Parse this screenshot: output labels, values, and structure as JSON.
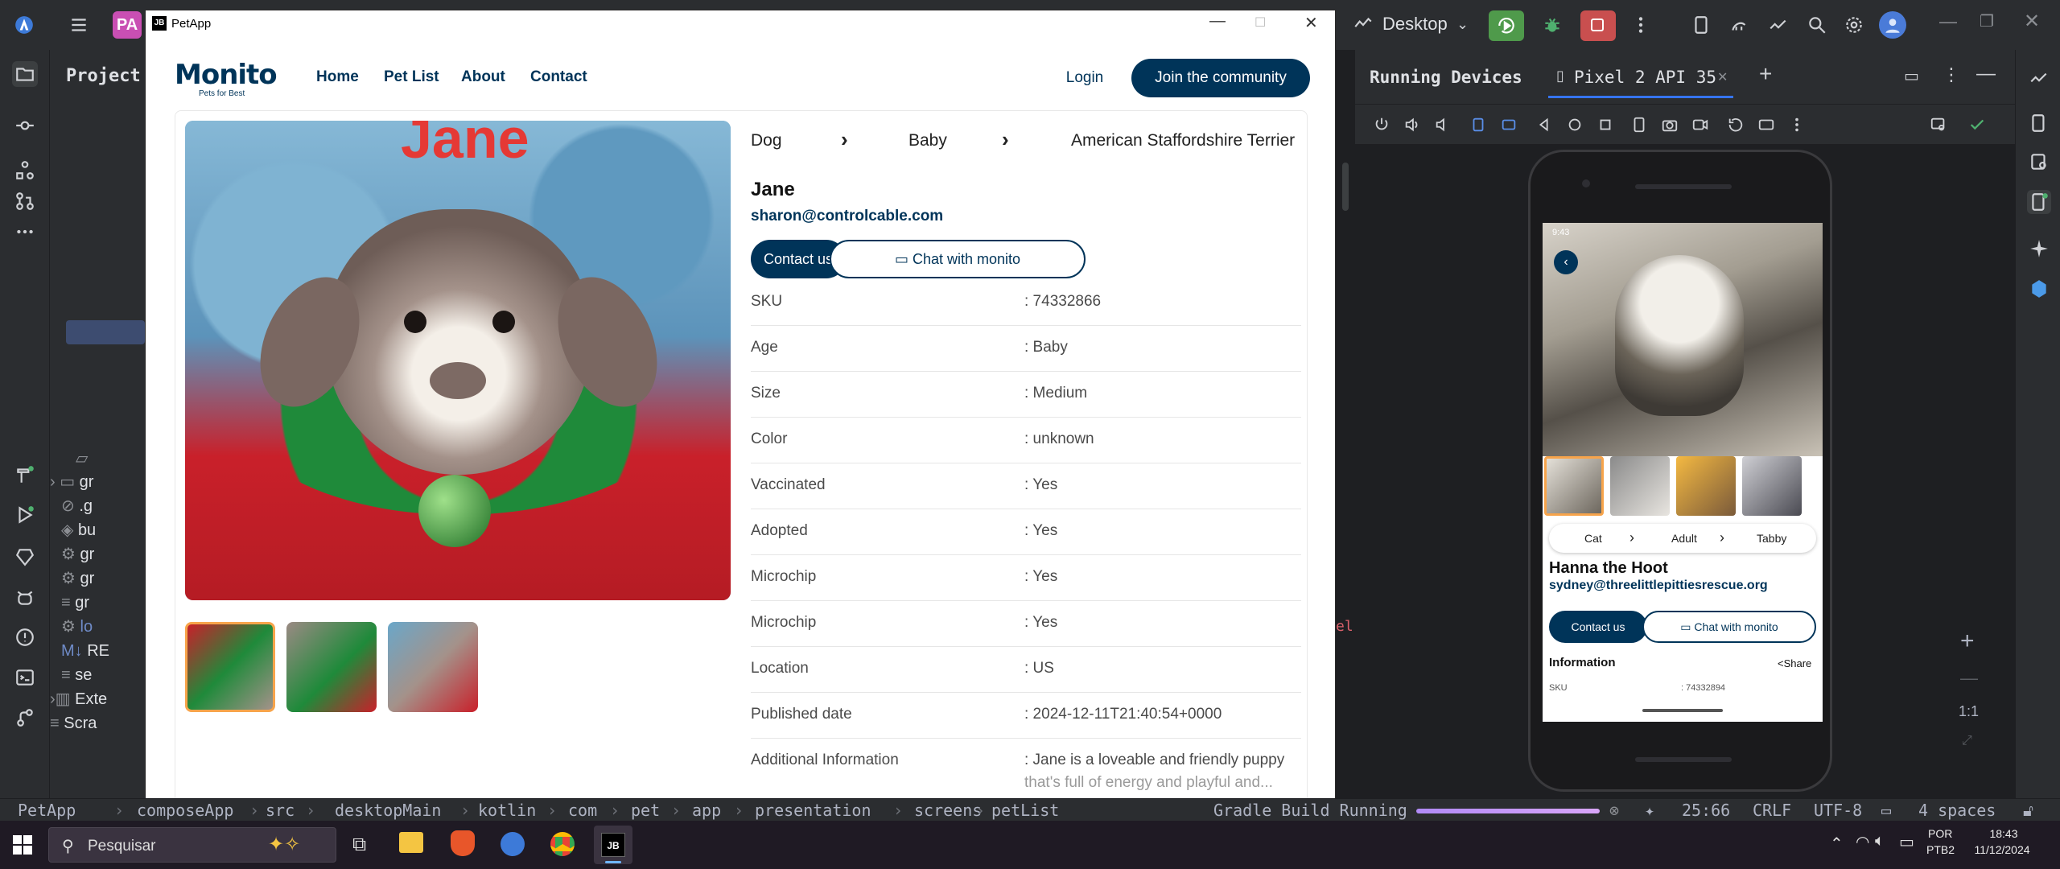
{
  "ide": {
    "project_badge": "PA",
    "device_selector": "Desktop",
    "panel_title": "Project",
    "running_devices_title": "Running Devices",
    "device_tab": "Pixel 2 API 35",
    "zoom_label": "1:1",
    "tree": [
      {
        "label": "gr"
      },
      {
        "label": ".g"
      },
      {
        "label": "bu"
      },
      {
        "label": "gr"
      },
      {
        "label": "gr"
      },
      {
        "label": "gr"
      },
      {
        "label": "lo"
      },
      {
        "label": "RE"
      },
      {
        "label": "se"
      },
      {
        "label": "Exte"
      },
      {
        "label": "Scra"
      }
    ],
    "editor_snippet": "el"
  },
  "statusbar": {
    "breadcrumb": [
      "PetApp",
      "composeApp",
      "src",
      "desktopMain",
      "kotlin",
      "com",
      "pet",
      "app",
      "presentation",
      "screens",
      "petList"
    ],
    "build_status": "Gradle Build Running",
    "position": "25:66",
    "line_ending": "CRLF",
    "encoding": "UTF-8",
    "indent": "4 spaces"
  },
  "taskbar": {
    "search_placeholder": "Pesquisar",
    "lang_top": "POR",
    "lang_bottom": "PTB2",
    "time": "18:43",
    "date": "11/12/2024"
  },
  "window": {
    "app_title": "PetApp",
    "icon_label": "JB"
  },
  "nav": {
    "brand": "Monito",
    "tagline": "Pets for Best",
    "links": [
      "Home",
      "Pet List",
      "About",
      "Contact"
    ],
    "login": "Login",
    "join": "Join the community"
  },
  "pet": {
    "breadcrumb": [
      "Dog",
      "Baby",
      "American Staffordshire Terrier"
    ],
    "name": "Jane",
    "email": "sharon@controlcable.com",
    "contact_btn": "Contact us",
    "chat_btn": "Chat with monito",
    "banner_text": "Jane",
    "info": [
      {
        "label": "SKU",
        "value": ": 74332866"
      },
      {
        "label": "Age",
        "value": ": Baby"
      },
      {
        "label": "Size",
        "value": ": Medium"
      },
      {
        "label": "Color",
        "value": ": unknown"
      },
      {
        "label": "Vaccinated",
        "value": ": Yes"
      },
      {
        "label": "Adopted",
        "value": ": Yes"
      },
      {
        "label": "Microchip",
        "value": ": Yes"
      },
      {
        "label": "Microchip",
        "value": ": Yes"
      },
      {
        "label": "Location",
        "value": ": US"
      },
      {
        "label": "Published date",
        "value": ": 2024-12-11T21:40:54+0000"
      },
      {
        "label": "Additional Information",
        "value": ": Jane is a loveable and friendly puppy"
      },
      {
        "label": "",
        "value": "that's full of energy and playful and..."
      }
    ]
  },
  "phone": {
    "crumbs": [
      "Cat",
      "Adult",
      "Tabby"
    ],
    "name": "Hanna the Hoot",
    "email": "sydney@threelittlepittiesrescue.org",
    "contact_btn": "Contact us",
    "chat_btn": "Chat with monito",
    "info_title": "Information",
    "share": "Share",
    "sku_label": "SKU",
    "sku_value": ": 74332894",
    "status_time": "9:43"
  },
  "colors": {
    "primary": "#003459",
    "ide_bg": "#2b2d30",
    "accent_orange": "#f7a582"
  }
}
